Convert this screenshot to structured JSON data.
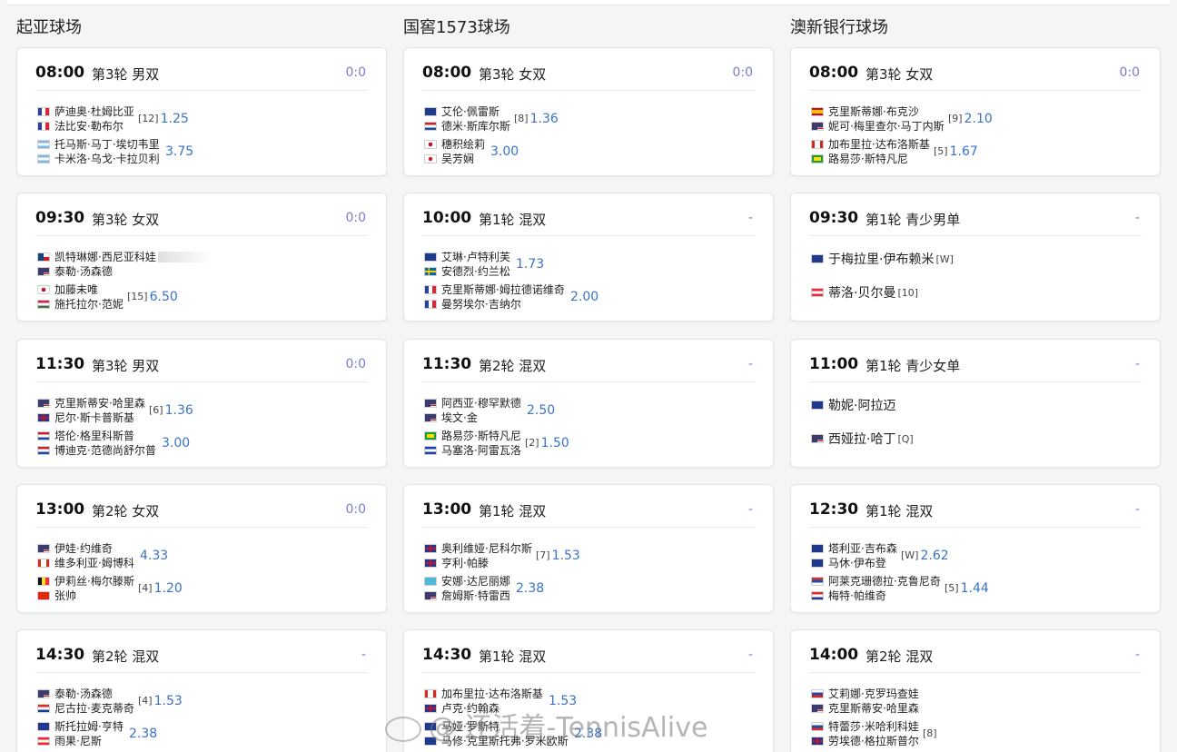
{
  "columns": [
    {
      "title": "起亚球场",
      "matches": [
        {
          "time": "08:00",
          "round": "第3轮 男双",
          "score": "0:0",
          "pairs": [
            {
              "players": [
                {
                  "flag": "fr",
                  "name": "萨迪奥·杜姆比亚"
                },
                {
                  "flag": "fr",
                  "name": "法比安·勒布尔"
                }
              ],
              "seed": "[12]",
              "odds": "1.25"
            },
            {
              "players": [
                {
                  "flag": "ar",
                  "name": "托马斯·马丁·埃切韦里"
                },
                {
                  "flag": "ar",
                  "name": "卡米洛·乌戈·卡拉贝利"
                }
              ],
              "seed": "",
              "odds": "3.75"
            }
          ]
        },
        {
          "time": "09:30",
          "round": "第3轮 女双",
          "score": "0:0",
          "pairs": [
            {
              "players": [
                {
                  "flag": "cz",
                  "name": "凯特琳娜·西尼亚科娃"
                },
                {
                  "flag": "us",
                  "name": "泰勒·汤森德"
                }
              ],
              "seed": "",
              "odds": ""
            },
            {
              "players": [
                {
                  "flag": "jp",
                  "name": "加藤未唯"
                },
                {
                  "flag": "hu",
                  "name": "施托拉尔·范妮"
                }
              ],
              "seed": "[15]",
              "odds": "6.50"
            }
          ]
        },
        {
          "time": "11:30",
          "round": "第3轮 男双",
          "score": "0:0",
          "pairs": [
            {
              "players": [
                {
                  "flag": "us",
                  "name": "克里斯蒂安·哈里森"
                },
                {
                  "flag": "gb",
                  "name": "尼尔·斯卡普斯基"
                }
              ],
              "seed": "[6]",
              "odds": "1.36"
            },
            {
              "players": [
                {
                  "flag": "nl",
                  "name": "塔伦·格里科斯普"
                },
                {
                  "flag": "nl",
                  "name": "博迪克·范德尚舒尔普"
                }
              ],
              "seed": "",
              "odds": "3.00"
            }
          ]
        },
        {
          "time": "13:00",
          "round": "第2轮 女双",
          "score": "0:0",
          "pairs": [
            {
              "players": [
                {
                  "flag": "us",
                  "name": "伊娃·约维奇"
                },
                {
                  "flag": "ca",
                  "name": "维多利亚·姆博科"
                }
              ],
              "seed": "",
              "odds": "4.33"
            },
            {
              "players": [
                {
                  "flag": "be",
                  "name": "伊莉丝·梅尔滕斯"
                },
                {
                  "flag": "cn",
                  "name": "张帅"
                }
              ],
              "seed": "[4]",
              "odds": "1.20"
            }
          ]
        },
        {
          "time": "14:30",
          "round": "第2轮 混双",
          "score": "-",
          "pairs": [
            {
              "players": [
                {
                  "flag": "us",
                  "name": "泰勒·汤森德"
                },
                {
                  "flag": "hr",
                  "name": "尼古拉·麦克蒂奇"
                }
              ],
              "seed": "[4]",
              "odds": "1.53"
            },
            {
              "players": [
                {
                  "flag": "au",
                  "name": "斯托拉姆·亨特"
                },
                {
                  "flag": "at",
                  "name": "雨果·尼斯"
                }
              ],
              "seed": "",
              "odds": "2.38"
            }
          ]
        }
      ]
    },
    {
      "title": "国窖1573球场",
      "matches": [
        {
          "time": "08:00",
          "round": "第3轮 女双",
          "score": "0:0",
          "pairs": [
            {
              "players": [
                {
                  "flag": "au",
                  "name": "艾伦·佩雷斯"
                },
                {
                  "flag": "nl",
                  "name": "德米·斯库尔斯"
                }
              ],
              "seed": "[8]",
              "odds": "1.36"
            },
            {
              "players": [
                {
                  "flag": "jp",
                  "name": "穗积绘莉"
                },
                {
                  "flag": "tw",
                  "name": "吴芳娴"
                }
              ],
              "seed": "",
              "odds": "3.00"
            }
          ]
        },
        {
          "time": "10:00",
          "round": "第1轮 混双",
          "score": "-",
          "pairs": [
            {
              "players": [
                {
                  "flag": "au",
                  "name": "艾琳·卢特利芙"
                },
                {
                  "flag": "se",
                  "name": "安德烈·约兰松"
                }
              ],
              "seed": "",
              "odds": "1.73"
            },
            {
              "players": [
                {
                  "flag": "fr",
                  "name": "克里斯蒂娜·姆拉德诺维奇"
                },
                {
                  "flag": "fr",
                  "name": "曼努埃尔·吉纳尔"
                }
              ],
              "seed": "",
              "odds": "2.00"
            }
          ]
        },
        {
          "time": "11:30",
          "round": "第2轮 混双",
          "score": "-",
          "pairs": [
            {
              "players": [
                {
                  "flag": "us",
                  "name": "阿西亚·穆罕默德"
                },
                {
                  "flag": "us",
                  "name": "埃文·金"
                }
              ],
              "seed": "",
              "odds": "2.50"
            },
            {
              "players": [
                {
                  "flag": "br",
                  "name": "路易莎·斯特凡尼"
                },
                {
                  "flag": "sv",
                  "name": "马塞洛·阿雷瓦洛"
                }
              ],
              "seed": "[2]",
              "odds": "1.50"
            }
          ]
        },
        {
          "time": "13:00",
          "round": "第1轮 混双",
          "score": "-",
          "pairs": [
            {
              "players": [
                {
                  "flag": "gb",
                  "name": "奥利维娅·尼科尔斯"
                },
                {
                  "flag": "gb",
                  "name": "亨利·帕滕"
                }
              ],
              "seed": "[7]",
              "odds": "1.53"
            },
            {
              "players": [
                {
                  "flag": "kz",
                  "name": "安娜·达尼丽娜"
                },
                {
                  "flag": "us",
                  "name": "詹姆斯·特雷西"
                }
              ],
              "seed": "",
              "odds": "2.38"
            }
          ]
        },
        {
          "time": "14:30",
          "round": "第1轮 混双",
          "score": "-",
          "pairs": [
            {
              "players": [
                {
                  "flag": "ca",
                  "name": "加布里拉·达布洛斯基"
                },
                {
                  "flag": "gb",
                  "name": "卢克·约翰森"
                }
              ],
              "seed": "",
              "odds": "1.53"
            },
            {
              "players": [
                {
                  "flag": "au",
                  "name": "马娅·罗斯特"
                },
                {
                  "flag": "au",
                  "name": "马修·克里斯托弗·罗米欧斯"
                }
              ],
              "seed": "",
              "odds": "2.38"
            }
          ]
        }
      ]
    },
    {
      "title": "澳新银行球场",
      "matches": [
        {
          "time": "08:00",
          "round": "第3轮 女双",
          "score": "0:0",
          "pairs": [
            {
              "players": [
                {
                  "flag": "es",
                  "name": "克里斯蒂娜·布克沙"
                },
                {
                  "flag": "us",
                  "name": "妮可·梅里查尔·马丁内斯"
                }
              ],
              "seed": "[9]",
              "odds": "2.10"
            },
            {
              "players": [
                {
                  "flag": "ca",
                  "name": "加布里拉·达布洛斯基"
                },
                {
                  "flag": "br",
                  "name": "路易莎·斯特凡尼"
                }
              ],
              "seed": "[5]",
              "odds": "1.67"
            }
          ]
        },
        {
          "time": "09:30",
          "round": "第1轮 青少男单",
          "score": "-",
          "singles": [
            {
              "flag": "au",
              "name": "于梅拉里·伊布赖米",
              "seed": "[W]"
            },
            {
              "flag": "at",
              "name": "蒂洛·贝尔曼",
              "seed": "[10]"
            }
          ]
        },
        {
          "time": "11:00",
          "round": "第1轮 青少女单",
          "score": "-",
          "singles": [
            {
              "flag": "au",
              "name": "勒妮·阿拉迈",
              "seed": ""
            },
            {
              "flag": "us",
              "name": "西娅拉·哈丁",
              "seed": "[Q]"
            }
          ]
        },
        {
          "time": "12:30",
          "round": "第1轮 混双",
          "score": "-",
          "pairs": [
            {
              "players": [
                {
                  "flag": "au",
                  "name": "塔利亚·吉布森"
                },
                {
                  "flag": "au",
                  "name": "马休·伊布登"
                }
              ],
              "seed": "[W]",
              "odds": "2.62"
            },
            {
              "players": [
                {
                  "flag": "rs",
                  "name": "阿莱克珊德拉·克鲁尼奇"
                },
                {
                  "flag": "hr",
                  "name": "梅特·帕维奇"
                }
              ],
              "seed": "[5]",
              "odds": "1.44"
            }
          ]
        },
        {
          "time": "14:00",
          "round": "第2轮 混双",
          "score": "-",
          "pairs": [
            {
              "players": [
                {
                  "flag": "ru",
                  "name": "艾莉娜·克罗玛查娃"
                },
                {
                  "flag": "us",
                  "name": "克里斯蒂安·哈里森"
                }
              ],
              "seed": "",
              "odds": ""
            },
            {
              "players": [
                {
                  "flag": "sk",
                  "name": "特蕾莎·米哈利科娃"
                },
                {
                  "flag": "gb",
                  "name": "劳埃德·格拉斯普尔"
                }
              ],
              "seed": "[8]",
              "odds": ""
            }
          ]
        }
      ]
    }
  ],
  "watermark": "@  还活着-TennisAlive"
}
